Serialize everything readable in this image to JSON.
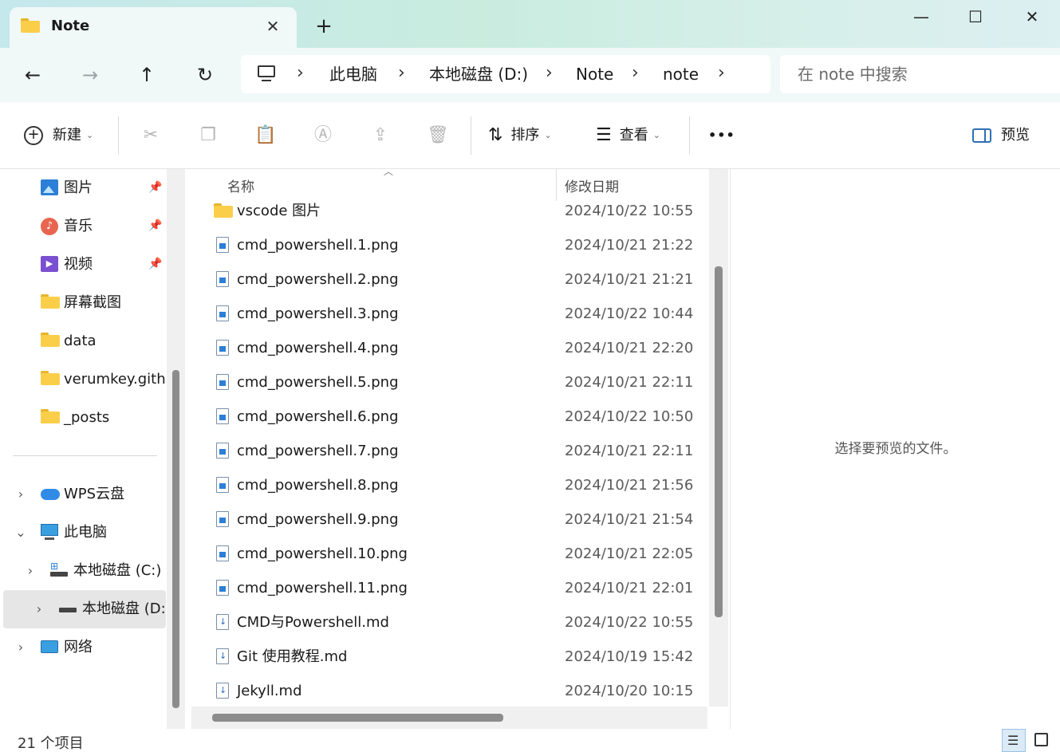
{
  "window": {
    "tab_title": "Note",
    "tab_close": "✕",
    "new_tab": "+",
    "minimize": "—",
    "maximize": "☐",
    "close": "✕"
  },
  "nav": {
    "back": "←",
    "forward": "→",
    "up": "↑",
    "refresh": "↻",
    "breadcrumb": [
      "此电脑",
      "本地磁盘 (D:)",
      "Note",
      "note"
    ],
    "search_placeholder": "在 note 中搜索"
  },
  "toolbar": {
    "new_label": "新建",
    "sort_label": "排序",
    "view_label": "查看",
    "more_label": "•••",
    "preview_label": "预览"
  },
  "sidebar": {
    "quick": [
      {
        "label": "图片",
        "icon": "pictures-icon",
        "pinned": true
      },
      {
        "label": "音乐",
        "icon": "music-icon",
        "pinned": true
      },
      {
        "label": "视频",
        "icon": "videos-icon",
        "pinned": true
      },
      {
        "label": "屏幕截图",
        "icon": "folder-icon",
        "pinned": false
      },
      {
        "label": "data",
        "icon": "folder-icon",
        "pinned": false
      },
      {
        "label": "verumkey.githu",
        "icon": "folder-icon",
        "pinned": false
      },
      {
        "label": "_posts",
        "icon": "folder-icon",
        "pinned": false
      }
    ],
    "tree": [
      {
        "label": "WPS云盘",
        "icon": "cloud-icon",
        "expanded": false,
        "indent": 0,
        "selected": false
      },
      {
        "label": "此电脑",
        "icon": "computer-icon",
        "expanded": true,
        "indent": 0,
        "selected": false
      },
      {
        "label": "本地磁盘 (C:)",
        "icon": "windows-drive-icon",
        "expanded": false,
        "indent": 1,
        "selected": false
      },
      {
        "label": "本地磁盘 (D:)",
        "icon": "drive-icon",
        "expanded": false,
        "indent": 1,
        "selected": true
      },
      {
        "label": "网络",
        "icon": "network-icon",
        "expanded": false,
        "indent": 0,
        "selected": false
      }
    ]
  },
  "filelist": {
    "columns": [
      "名称",
      "修改日期"
    ],
    "files": [
      {
        "name": "vscode 图片",
        "type": "folder",
        "date": "2024/10/22 10:55"
      },
      {
        "name": "cmd_powershell.1.png",
        "type": "png",
        "date": "2024/10/21 21:22"
      },
      {
        "name": "cmd_powershell.2.png",
        "type": "png",
        "date": "2024/10/21 21:21"
      },
      {
        "name": "cmd_powershell.3.png",
        "type": "png",
        "date": "2024/10/22 10:44"
      },
      {
        "name": "cmd_powershell.4.png",
        "type": "png",
        "date": "2024/10/21 22:20"
      },
      {
        "name": "cmd_powershell.5.png",
        "type": "png",
        "date": "2024/10/21 22:11"
      },
      {
        "name": "cmd_powershell.6.png",
        "type": "png",
        "date": "2024/10/22 10:50"
      },
      {
        "name": "cmd_powershell.7.png",
        "type": "png",
        "date": "2024/10/21 22:11"
      },
      {
        "name": "cmd_powershell.8.png",
        "type": "png",
        "date": "2024/10/21 21:56"
      },
      {
        "name": "cmd_powershell.9.png",
        "type": "png",
        "date": "2024/10/21 21:54"
      },
      {
        "name": "cmd_powershell.10.png",
        "type": "png",
        "date": "2024/10/21 22:05"
      },
      {
        "name": "cmd_powershell.11.png",
        "type": "png",
        "date": "2024/10/21 22:01"
      },
      {
        "name": "CMD与Powershell.md",
        "type": "md",
        "date": "2024/10/22 10:55"
      },
      {
        "name": "Git 使用教程.md",
        "type": "md",
        "date": "2024/10/19 15:42"
      },
      {
        "name": "Jekyll.md",
        "type": "md",
        "date": "2024/10/20 10:15"
      }
    ]
  },
  "preview": {
    "message": "选择要预览的文件。"
  },
  "status": {
    "item_count": "21 个项目"
  }
}
